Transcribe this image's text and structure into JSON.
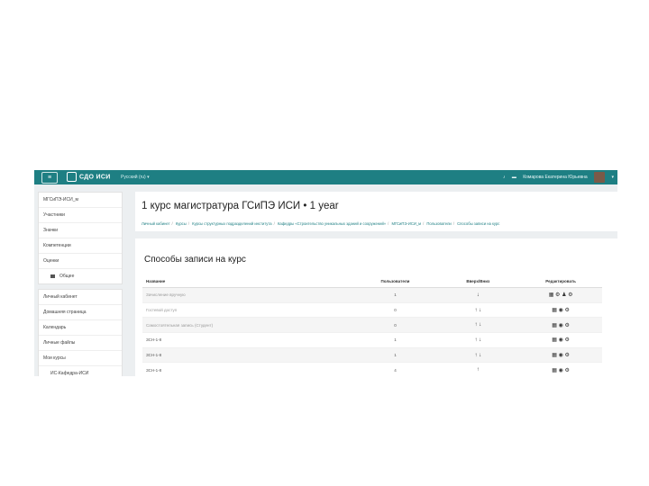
{
  "navbar": {
    "menu_icon": "hamburger-icon",
    "logo_text": "СДО ИСИ",
    "language": "Русский (ru) ▾",
    "notifications_icon": "bell-icon",
    "messages_icon": "chat-icon",
    "user_name": "Комарова Екатерина Юрьевна",
    "user_menu_icon": "chevron-down-icon"
  },
  "sidebar": {
    "course_items": [
      {
        "label": "МГСиПЭ-ИСИ_м"
      },
      {
        "label": "Участники"
      },
      {
        "label": "Значки"
      },
      {
        "label": "Компетенции"
      },
      {
        "label": "Оценки"
      },
      {
        "label": "Общее"
      }
    ],
    "site_items": [
      {
        "label": "Личный кабинет"
      },
      {
        "label": "Домашняя страница"
      },
      {
        "label": "Календарь"
      },
      {
        "label": "Личные файлы"
      },
      {
        "label": "Мои курсы"
      },
      {
        "label": "ИС-Кафедра-ИСИ"
      }
    ]
  },
  "header": {
    "title": "1 курс магистратура ГСиПЭ ИСИ • 1 year",
    "breadcrumb": [
      "Личный кабинет",
      "Курсы",
      "Курсы структурных подразделений института",
      "Кафедры «Строительство уникальных зданий и сооружений»",
      "МГСиПЭ-ИСИ_м",
      "Пользователи",
      "Способы записи на курс"
    ]
  },
  "enrolment": {
    "title": "Способы записи на курс",
    "columns": [
      "Название",
      "Пользователи",
      "Вверх/Вниз",
      "Редактировать"
    ],
    "rows": [
      {
        "name": "Зачисление вручную",
        "users": "1",
        "updown": "↓",
        "edit": "▦ ⚙ ♟ ⚙",
        "dim": true
      },
      {
        "name": "Гостевой доступ",
        "users": "0",
        "updown": "↑ ↓",
        "edit": "▦ ◉ ⚙",
        "dim": true
      },
      {
        "name": "Самостоятельная запись (Студент)",
        "users": "0",
        "updown": "↑ ↓",
        "edit": "▦ ◉ ⚙",
        "dim": true
      },
      {
        "name": "ЗСН-1-8",
        "users": "1",
        "updown": "↑ ↓",
        "edit": "▦ ◉ ⚙",
        "dim": false
      },
      {
        "name": "ЗСН-1-8",
        "users": "1",
        "updown": "↑ ↓",
        "edit": "▦ ◉ ⚙",
        "dim": false
      },
      {
        "name": "ЗСН-1-8",
        "users": "4",
        "updown": "↑",
        "edit": "▦ ◉ ⚙",
        "dim": false
      }
    ]
  }
}
